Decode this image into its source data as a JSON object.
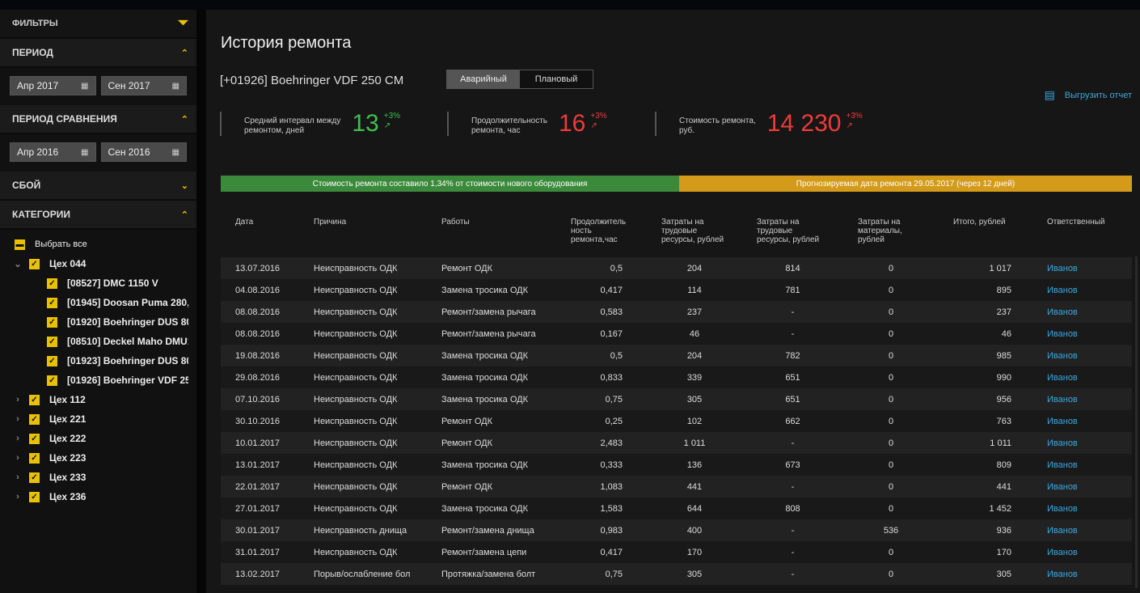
{
  "sidebar": {
    "filters_title": "ФИЛЬТРЫ",
    "period": {
      "title": "ПЕРИОД",
      "from": "Апр 2017",
      "to": "Сен 2017"
    },
    "comparison": {
      "title": "ПЕРИОД СРАВНЕНИЯ",
      "from": "Апр 2016",
      "to": "Сен 2016"
    },
    "failure": {
      "title": "СБОЙ"
    },
    "categories": {
      "title": "КАТЕГОРИИ",
      "select_all": "Выбрать все",
      "groups": [
        {
          "label": "Цех 044",
          "children": [
            "[08527] DMC 1150 V",
            "[01945] Doosan Puma 280,",
            "[01920] Boehringer DUS 80(",
            "[08510] Deckel Maho DMU1",
            "[01923] Boehringer DUS 80(",
            "[01926] Boehringer VDF 25("
          ]
        },
        {
          "label": "Цех 112"
        },
        {
          "label": "Цех 221"
        },
        {
          "label": "Цех 222"
        },
        {
          "label": "Цех 223"
        },
        {
          "label": "Цех 233"
        },
        {
          "label": "Цех 236"
        }
      ]
    }
  },
  "main": {
    "title": "История ремонта",
    "machine": "[+01926] Boehringer VDF 250 CM",
    "tabs": [
      "Аварийный",
      "Плановый"
    ],
    "export": "Выгрузить отчет",
    "kpis": [
      {
        "label1": "Средний интервал между",
        "label2": "ремонтом, дней",
        "value": "13",
        "delta": "+3%"
      },
      {
        "label1": "Продолжительность",
        "label2": "ремонта, час",
        "value": "16",
        "delta": "+3%"
      },
      {
        "label1": "Стоимость ремонта,",
        "label2": "руб.",
        "value": "14 230",
        "delta": "+3%"
      }
    ],
    "banner_left": "Стоимость ремонта составило 1,34% от стоимости нового оборудования",
    "banner_right": "Прогнозируемая дата ремонта 29.05.2017 (через 12 дней)",
    "colors": {
      "accent": "#e8c100",
      "good": "#3fbf4a",
      "bad": "#f03a3a",
      "link": "#3ba7e0"
    }
  },
  "table": {
    "headers": [
      "Дата",
      "Причина",
      "Работы",
      "Продолжитель ность ремонта,час",
      "Затраты на трудовые ресурсы, рублей",
      "Затраты на трудовые ресурсы, рублей",
      "Затраты на материалы, рублей",
      "Итого, рублей",
      "Ответственный"
    ],
    "rows": [
      [
        "13.07.2016",
        "Неисправность ОДК",
        "Ремонт ОДК",
        "0,5",
        "204",
        "814",
        "0",
        "1 017",
        "Иванов"
      ],
      [
        "04.08.2016",
        "Неисправность ОДК",
        "Замена тросика ОДК",
        "0,417",
        "114",
        "781",
        "0",
        "895",
        "Иванов"
      ],
      [
        "08.08.2016",
        "Неисправность ОДК",
        "Ремонт/замена рычага",
        "0,583",
        "237",
        "-",
        "0",
        "237",
        "Иванов"
      ],
      [
        "08.08.2016",
        "Неисправность ОДК",
        "Ремонт/замена рычага",
        "0,167",
        "46",
        "-",
        "0",
        "46",
        "Иванов"
      ],
      [
        "19.08.2016",
        "Неисправность ОДК",
        "Замена тросика ОДК",
        "0,5",
        "204",
        "782",
        "0",
        "985",
        "Иванов"
      ],
      [
        "29.08.2016",
        "Неисправность ОДК",
        "Замена тросика ОДК",
        "0,833",
        "339",
        "651",
        "0",
        "990",
        "Иванов"
      ],
      [
        "07.10.2016",
        "Неисправность ОДК",
        "Замена тросика ОДК",
        "0,75",
        "305",
        "651",
        "0",
        "956",
        "Иванов"
      ],
      [
        "30.10.2016",
        "Неисправность ОДК",
        "Ремонт ОДК",
        "0,25",
        "102",
        "662",
        "0",
        "763",
        "Иванов"
      ],
      [
        "10.01.2017",
        "Неисправность ОДК",
        "Ремонт ОДК",
        "2,483",
        "1 011",
        "-",
        "0",
        "1 011",
        "Иванов"
      ],
      [
        "13.01.2017",
        "Неисправность ОДК",
        "Замена тросика ОДК",
        "0,333",
        "136",
        "673",
        "0",
        "809",
        "Иванов"
      ],
      [
        "22.01.2017",
        "Неисправность ОДК",
        "Ремонт ОДК",
        "1,083",
        "441",
        "-",
        "0",
        "441",
        "Иванов"
      ],
      [
        "27.01.2017",
        "Неисправность ОДК",
        "Замена тросика ОДК",
        "1,583",
        "644",
        "808",
        "0",
        "1 452",
        "Иванов"
      ],
      [
        "30.01.2017",
        "Неисправность днища",
        "Ремонт/замена днища",
        "0,983",
        "400",
        "-",
        "536",
        "936",
        "Иванов"
      ],
      [
        "31.01.2017",
        "Неисправность ОДК",
        "Ремонт/замена цепи",
        "0,417",
        "170",
        "-",
        "0",
        "170",
        "Иванов"
      ],
      [
        "13.02.2017",
        "Порыв/ослабление бол",
        "Протяжка/замена болт",
        "0,75",
        "305",
        "-",
        "0",
        "305",
        "Иванов"
      ]
    ]
  }
}
